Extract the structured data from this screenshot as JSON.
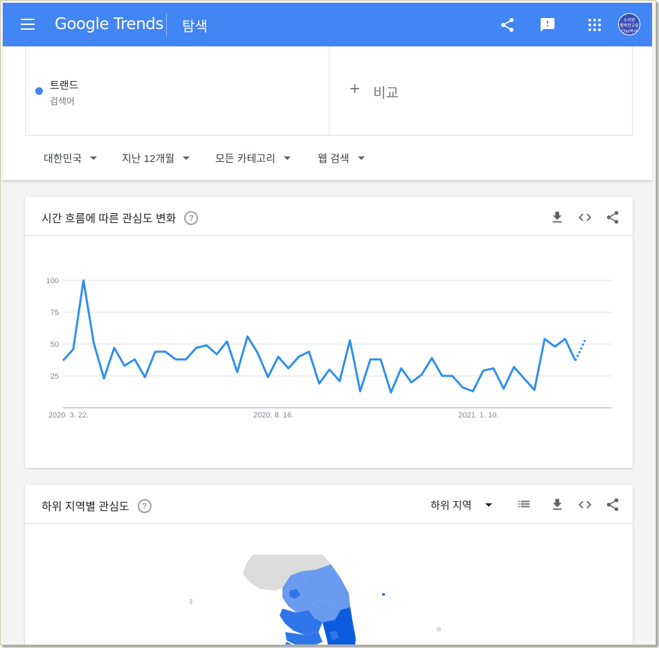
{
  "header": {
    "logo": "Google Trends",
    "title": "탐색",
    "avatar_text": [
      "소리방",
      "행복한교회",
      "Choi목사"
    ]
  },
  "search": {
    "term": {
      "name": "트랜드",
      "type": "검색어",
      "color": "#4285f4"
    },
    "compare_label": "비교"
  },
  "filters": [
    "대한민국",
    "지난 12개월",
    "모든 카테고리",
    "웹 검색"
  ],
  "interest_over_time": {
    "title": "시간 흐름에 따른 관심도 변화"
  },
  "subregion": {
    "title": "하위 지역별 관심도",
    "select_value": "하위 지역"
  },
  "colors": {
    "accent": "#4285f4",
    "line": "#2c8ef0",
    "map_dark": "#0b5ddd",
    "map_mid": "#2f76e8",
    "map_light": "#6a9bf0",
    "map_none": "#dcdcdc"
  },
  "chart_data": {
    "type": "line",
    "x_tick_labels": [
      "2020. 3. 22.",
      "2020. 8. 16.",
      "2021. 1. 10."
    ],
    "y_ticks": [
      25,
      50,
      75,
      100
    ],
    "ylim": [
      0,
      100
    ],
    "grid": true,
    "partial_last_segment": true,
    "series": [
      {
        "values": [
          37,
          46,
          100,
          51,
          23,
          47,
          33,
          38,
          24,
          44,
          44,
          38,
          38,
          47,
          49,
          42,
          52,
          28,
          56,
          43,
          24,
          40,
          31,
          40,
          44,
          19,
          30,
          21,
          53,
          13,
          38,
          38,
          12,
          31,
          20,
          26,
          39,
          25,
          25,
          16,
          13,
          29,
          31,
          15,
          32,
          23,
          14,
          54,
          48,
          54,
          37,
          54
        ]
      }
    ]
  }
}
